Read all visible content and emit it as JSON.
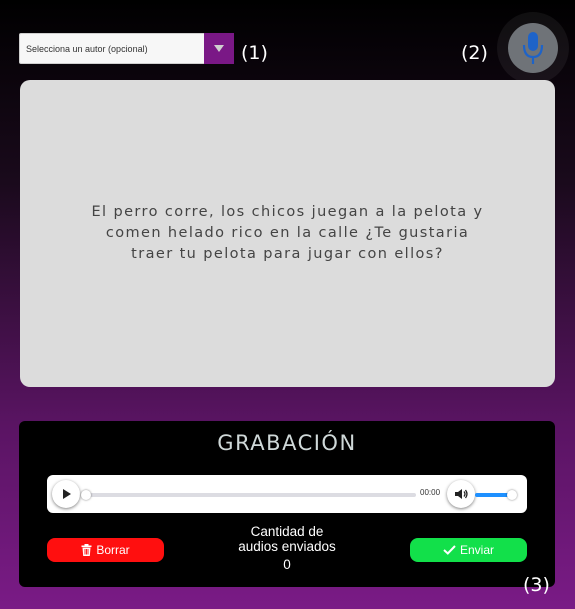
{
  "author_select": {
    "placeholder": "Selecciona un autor (opcional)"
  },
  "markers": {
    "m1": "(1)",
    "m2": "(2)",
    "m3": "(3)"
  },
  "reading_text": "El perro corre, los chicos juegan a la pelota y comen helado rico en la calle ¿Te gustaria traer tu pelota para jugar con ellos?",
  "recording": {
    "title": "GRABACIÓN",
    "player": {
      "time": "00:00",
      "progress": 0,
      "volume": 0.93
    },
    "delete_label": "Borrar",
    "send_label": "Enviar",
    "count_label_line1": "Cantidad de",
    "count_label_line2": "audios enviados",
    "count_value": "0"
  },
  "colors": {
    "accent": "#7a1886",
    "delete": "#ff0f0f",
    "send": "#12e04a",
    "panel": "#dcdcdc"
  },
  "icons": {
    "select_arrow": "triangle-down-icon",
    "mic": "microphone-icon",
    "play": "play-icon",
    "volume": "volume-icon",
    "trash": "trash-icon",
    "check": "check-icon"
  }
}
